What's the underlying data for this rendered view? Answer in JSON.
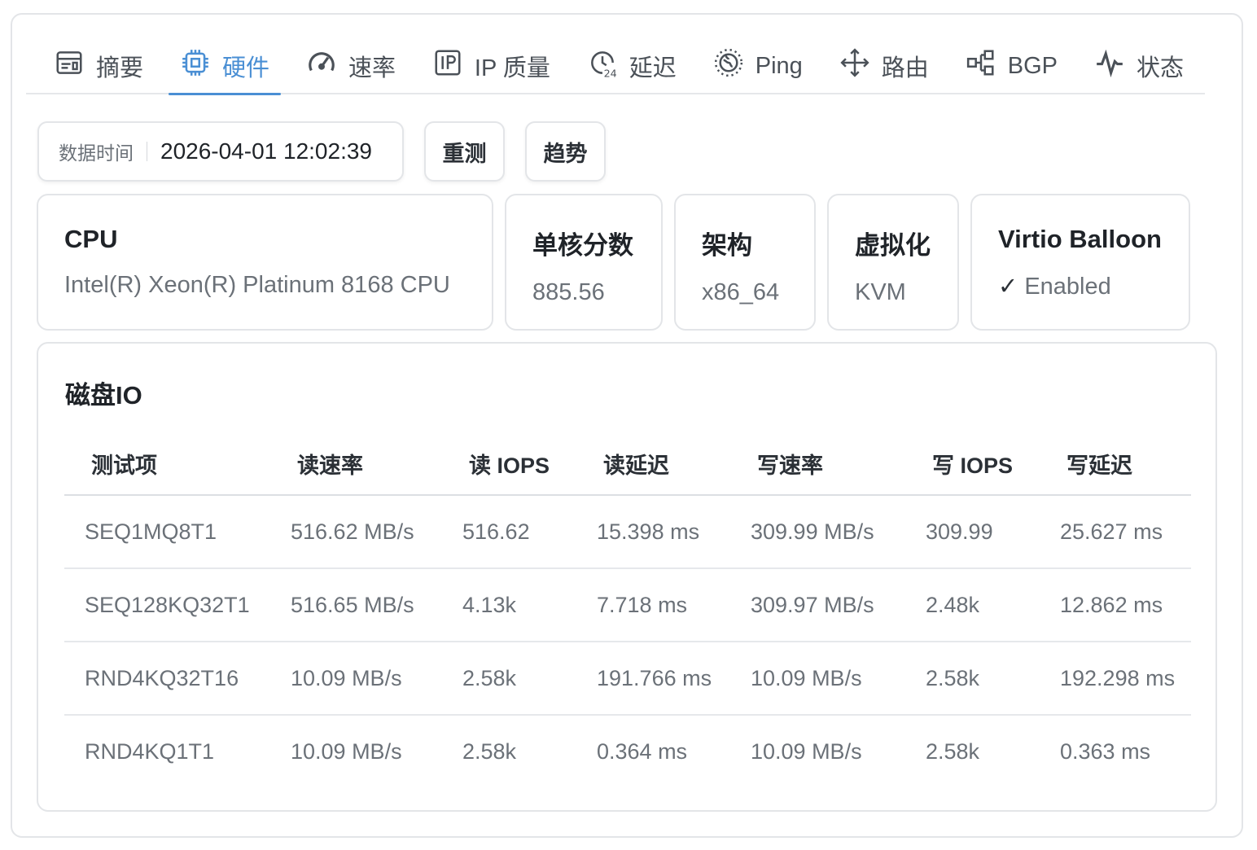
{
  "tabs": [
    {
      "label": "摘要",
      "icon": "summary-icon"
    },
    {
      "label": "硬件",
      "icon": "chip-icon",
      "active": true
    },
    {
      "label": "速率",
      "icon": "speedometer-icon"
    },
    {
      "label": "IP 质量",
      "icon": "ip-icon"
    },
    {
      "label": "延迟",
      "icon": "clock-24-icon"
    },
    {
      "label": "Ping",
      "icon": "globe-icon"
    },
    {
      "label": "路由",
      "icon": "route-icon"
    },
    {
      "label": "BGP",
      "icon": "network-icon"
    },
    {
      "label": "状态",
      "icon": "activity-icon"
    }
  ],
  "toolbar": {
    "time_label": "数据时间",
    "time_value": "2026-04-01 12:02:39",
    "retest_label": "重测",
    "trend_label": "趋势"
  },
  "cards": {
    "cpu": {
      "title": "CPU",
      "value": "Intel(R) Xeon(R) Platinum 8168 CPU"
    },
    "single_core": {
      "title": "单核分数",
      "value": "885.56"
    },
    "arch": {
      "title": "架构",
      "value": "x86_64"
    },
    "virt": {
      "title": "虚拟化",
      "value": "KVM"
    },
    "balloon": {
      "title": "Virtio Balloon",
      "check": "✓",
      "value": "Enabled"
    }
  },
  "disk": {
    "title": "磁盘IO",
    "headers": [
      "测试项",
      "读速率",
      "读 IOPS",
      "读延迟",
      "写速率",
      "写 IOPS",
      "写延迟"
    ],
    "rows": [
      [
        "SEQ1MQ8T1",
        "516.62 MB/s",
        "516.62",
        "15.398 ms",
        "309.99 MB/s",
        "309.99",
        "25.627 ms"
      ],
      [
        "SEQ128KQ32T1",
        "516.65 MB/s",
        "4.13k",
        "7.718 ms",
        "309.97 MB/s",
        "2.48k",
        "12.862 ms"
      ],
      [
        "RND4KQ32T16",
        "10.09 MB/s",
        "2.58k",
        "191.766 ms",
        "10.09 MB/s",
        "2.58k",
        "192.298 ms"
      ],
      [
        "RND4KQ1T1",
        "10.09 MB/s",
        "2.58k",
        "0.364 ms",
        "10.09 MB/s",
        "2.58k",
        "0.363 ms"
      ]
    ]
  },
  "colors": {
    "accent": "#4a8fd4",
    "muted_text": "#6b7178",
    "border": "#e3e5e8"
  }
}
